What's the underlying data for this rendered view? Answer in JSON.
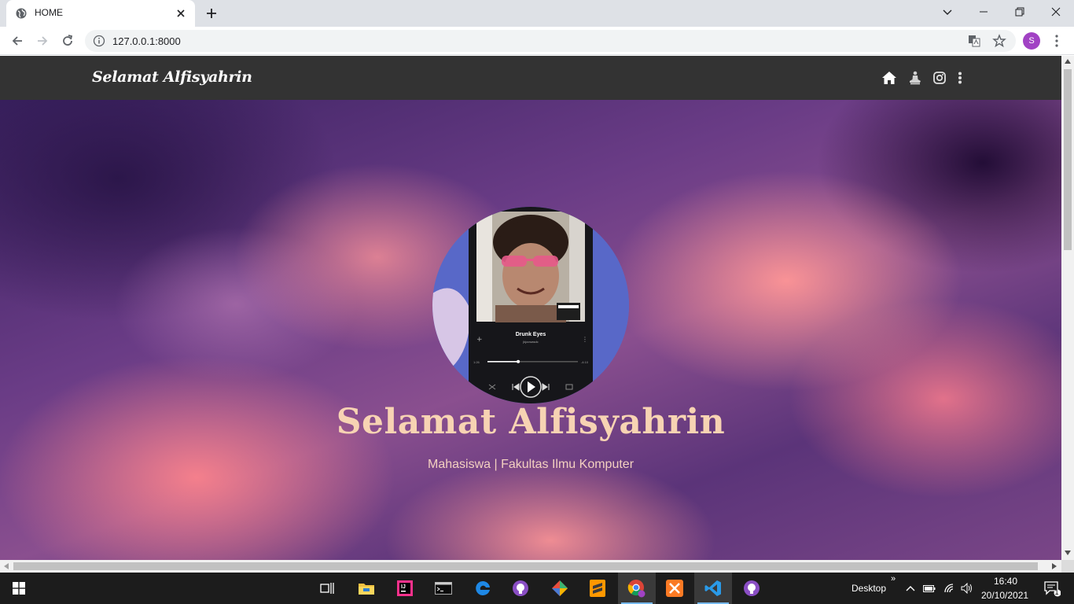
{
  "browser": {
    "tab_title": "HOME",
    "url": "127.0.0.1:8000",
    "profile_initial": "S"
  },
  "site": {
    "brand": "Selamat Alfisyahrin",
    "nav_icons": [
      "home-icon",
      "user-meditate-icon",
      "instagram-icon",
      "more-vertical-icon"
    ],
    "hero_title": "Selamat Alfisyahrin",
    "hero_subtitle": "Mahasiswa | Fakultas Ilmu Komputer",
    "profile_player": {
      "track": "Drunk Eyes",
      "artist": "jkjocwasdc",
      "elapsed": "1:26",
      "remaining": "-4:10",
      "progress": 0.34
    }
  },
  "taskbar": {
    "desktop_label": "Desktop",
    "time": "16:40",
    "date": "20/10/2021",
    "notification_count": "1",
    "apps": [
      "task-view-icon",
      "file-explorer-icon",
      "intellij-icon",
      "terminal-icon",
      "edge-icon",
      "github-desktop-icon",
      "git-icon",
      "sublime-icon",
      "chrome-icon",
      "xampp-icon",
      "vscode-icon",
      "github-icon"
    ]
  },
  "colors": {
    "navbar": "#333333",
    "hero_text": "#f7d3b3",
    "taskbar": "#1c1c1c"
  }
}
